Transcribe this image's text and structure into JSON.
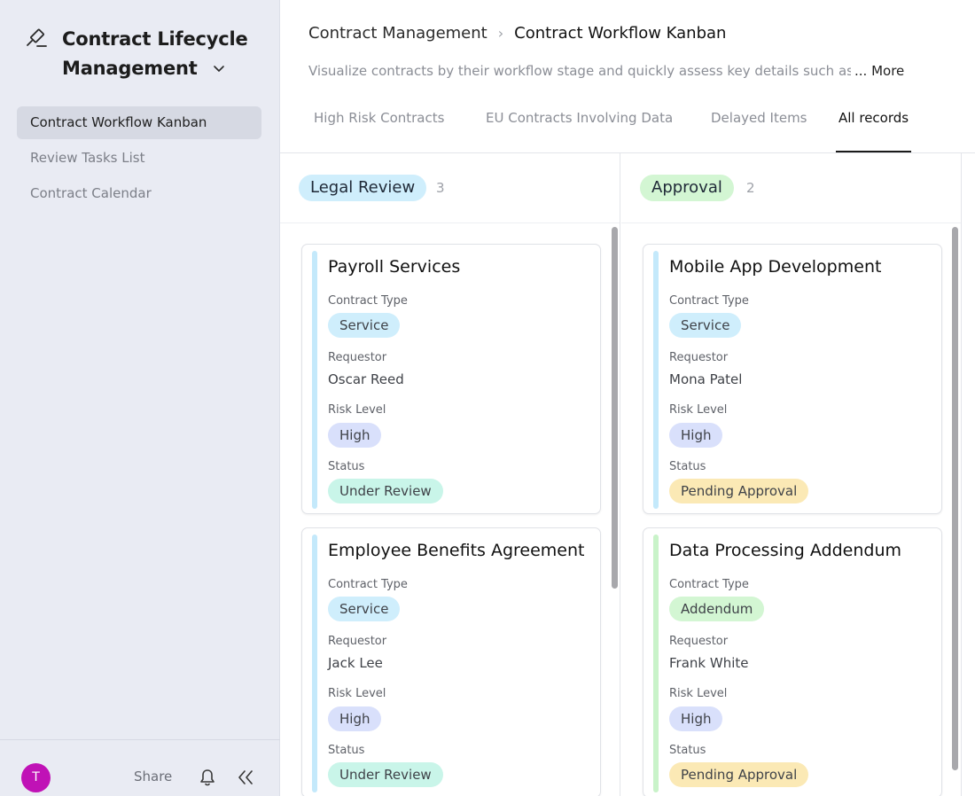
{
  "app": {
    "title": "Contract Lifecycle Management",
    "title_line1": "Contract Lifecycle",
    "title_line2": "Management",
    "icon": "gavel-icon"
  },
  "sidebar": {
    "items": [
      {
        "label": "Contract Workflow Kanban",
        "active": true
      },
      {
        "label": "Review Tasks List",
        "active": false
      },
      {
        "label": "Contract Calendar",
        "active": false
      }
    ],
    "footer": {
      "avatar_initial": "T",
      "avatar_color": "#c012b6",
      "share_label": "Share"
    }
  },
  "header": {
    "breadcrumb_parent": "Contract Management",
    "breadcrumb_current": "Contract Workflow Kanban",
    "description": "Visualize contracts by their workflow stage and quickly assess key details such as co",
    "more_label": "... More"
  },
  "tabs": [
    {
      "label": "High Risk Contracts",
      "active": false
    },
    {
      "label": "EU Contracts Involving Data",
      "active": false
    },
    {
      "label": "Delayed Items",
      "active": false
    },
    {
      "label": "All records",
      "active": true
    }
  ],
  "field_labels": {
    "contract_type": "Contract Type",
    "requestor": "Requestor",
    "risk_level": "Risk Level",
    "status": "Status"
  },
  "columns": [
    {
      "name": "Legal Review",
      "count": "3",
      "color": "#cfeefc",
      "cards": [
        {
          "title": "Payroll Services",
          "contract_type": "Service",
          "requestor": "Oscar Reed",
          "risk_level": "High",
          "status": "Under Review",
          "bar_color": "#c4e9fb"
        },
        {
          "title": "Employee Benefits Agreement",
          "contract_type": "Service",
          "requestor": "Jack Lee",
          "risk_level": "High",
          "status": "Under Review",
          "bar_color": "#c4e9fb"
        }
      ]
    },
    {
      "name": "Approval",
      "count": "2",
      "color": "#d3f6d3",
      "cards": [
        {
          "title": "Mobile App Development",
          "contract_type": "Service",
          "requestor": "Mona Patel",
          "risk_level": "High",
          "status": "Pending Approval",
          "bar_color": "#c4e9fb"
        },
        {
          "title": "Data Processing Addendum",
          "contract_type": "Addendum",
          "requestor": "Frank White",
          "risk_level": "High",
          "status": "Pending Approval",
          "bar_color": "#c9f3c9"
        }
      ]
    }
  ],
  "tag_colors": {
    "Service": "#cfeefc",
    "Addendum": "#d3f6d3",
    "High": "#d9e0fb",
    "Under Review": "#c9f5e9",
    "Pending Approval": "#fbe9b5"
  }
}
